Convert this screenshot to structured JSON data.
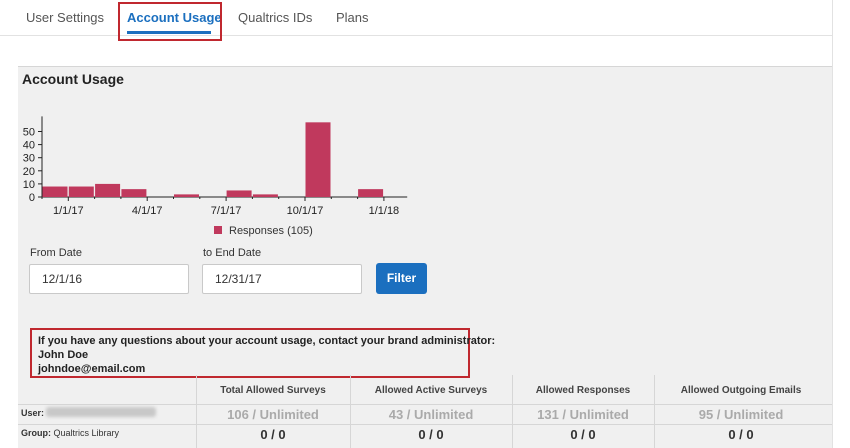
{
  "tabs": [
    {
      "label": "User Settings"
    },
    {
      "label": "Account Usage"
    },
    {
      "label": "Qualtrics IDs"
    },
    {
      "label": "Plans"
    }
  ],
  "panel": {
    "title": "Account Usage"
  },
  "chart_data": {
    "type": "bar",
    "x": [
      "Dec 2016",
      "Jan 2017",
      "Feb 2017",
      "Mar 2017",
      "Apr 2017",
      "May 2017",
      "Jun 2017",
      "Jul 2017",
      "Aug 2017",
      "Sep 2017",
      "Oct 2017",
      "Nov 2017",
      "Dec 2017",
      "Jan 2018"
    ],
    "series": [
      {
        "name": "Responses (105)",
        "values": [
          8,
          8,
          10,
          6,
          0,
          2,
          0,
          5,
          2,
          0,
          57,
          0,
          6,
          0
        ]
      }
    ],
    "y_ticks": [
      "0",
      "10",
      "20",
      "30",
      "40",
      "50"
    ],
    "x_ticks": [
      "1/1/17",
      "4/1/17",
      "7/1/17",
      "10/1/17",
      "1/1/18"
    ],
    "ylim": [
      0,
      60
    ],
    "color": "#c0395d",
    "legend": "bottom",
    "grid": false
  },
  "form": {
    "from_label": "From Date",
    "from_value": "12/1/16",
    "to_label": "to End Date",
    "to_value": "12/31/17",
    "filter_label": "Filter"
  },
  "contact": {
    "line": "If you have any questions about your account usage, contact your brand administrator:",
    "name": "John Doe",
    "email": "johndoe@email.com"
  },
  "stats": {
    "headers": [
      "Total Allowed Surveys",
      "Allowed Active Surveys",
      "Allowed Responses",
      "Allowed Outgoing Emails"
    ],
    "user_label": "User:",
    "group_label": "Group:",
    "group_name": "Qualtrics Library",
    "user_values": [
      "106 / Unlimited",
      "43 / Unlimited",
      "131 / Unlimited",
      "95 / Unlimited"
    ],
    "group_values": [
      "0 / 0",
      "0 / 0",
      "0 / 0",
      "0 / 0"
    ]
  },
  "colors": {
    "accent": "#1b6fbf",
    "highlight": "#c0282f",
    "bar": "#c0395d",
    "panel": "#f0f0f0"
  }
}
